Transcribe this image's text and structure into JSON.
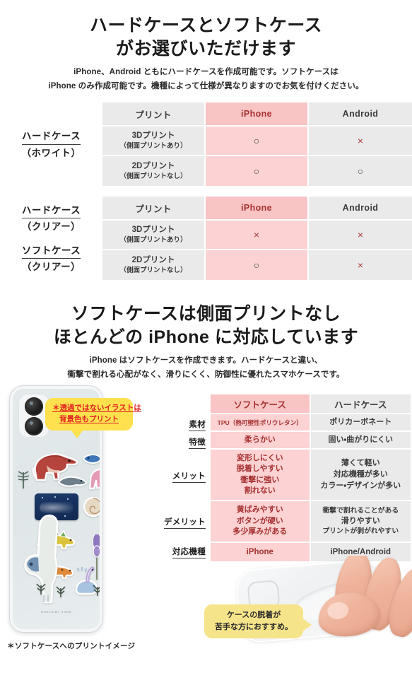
{
  "section1": {
    "heading_lines": [
      "ハードケースとソフトケース",
      "がお選びいただけます"
    ],
    "sub_lines": [
      "iPhone、Android ともにハードケースを作成可能です。ソフトケースは",
      "iPhone のみ作成可能です。機種によって仕様が異なりますのでお気を付けください。"
    ],
    "tables": [
      {
        "labels": [
          {
            "main": "ハードケース",
            "paren": "（ホワイト）"
          }
        ],
        "columns": [
          "プリント",
          "iPhone",
          "Android"
        ],
        "rows": [
          {
            "print_main": "3Dプリント",
            "print_sub": "（側面プリントあり）",
            "iphone": "○",
            "android": "×"
          },
          {
            "print_main": "2Dプリント",
            "print_sub": "（側面プリントなし）",
            "iphone": "○",
            "android": "○"
          }
        ]
      },
      {
        "labels": [
          {
            "main": "ハードケース",
            "paren": "（クリアー）"
          },
          {
            "main": "ソフトケース",
            "paren": "（クリアー）"
          }
        ],
        "columns": [
          "プリント",
          "iPhone",
          "Android"
        ],
        "rows": [
          {
            "print_main": "3Dプリント",
            "print_sub": "（側面プリントあり）",
            "iphone": "×",
            "android": "×"
          },
          {
            "print_main": "2Dプリント",
            "print_sub": "（側面プリントなし）",
            "iphone": "○",
            "android": "×"
          }
        ]
      }
    ]
  },
  "section2": {
    "heading_lines": [
      "ソフトケースは側面プリントなし",
      "ほとんどの iPhone に対応しています"
    ],
    "sub_lines": [
      "iPhone はソフトケースを作成できます。ハードケースと違い、",
      "衝撃で割れる心配がなく、滑りにくく、防御性に優れたスマホケースです。"
    ],
    "callout_top": {
      "lines": [
        "＊透過ではないイラストは",
        "背景色もプリント"
      ]
    },
    "callout_bottom": {
      "lines": [
        "ケースの脱着が",
        "苦手な方におすすめ。"
      ]
    },
    "phone_brand_text": "Chocolat iroha",
    "comparison": {
      "columns": [
        "ソフトケース",
        "ハードケース"
      ],
      "rows": [
        {
          "label": "素材",
          "soft": [
            "TPU（熱可塑性ポリウレタン）"
          ],
          "hard": [
            "ポリカーボネート"
          ],
          "soft_small": true
        },
        {
          "label": "特徴",
          "soft": [
            "柔らかい"
          ],
          "hard": [
            "固い・曲がりにくい"
          ]
        },
        {
          "label": "メリット",
          "soft": [
            "変形しにくい",
            "脱着しやすい",
            "衝撃に強い",
            "割れない"
          ],
          "hard": [
            "薄くて軽い",
            "対応機種が多い",
            "カラー・デザインが多い"
          ]
        },
        {
          "label": "デメリット",
          "soft": [
            "黄ばみやすい",
            "ボタンが硬い",
            "多少厚みがある"
          ],
          "hard": [
            "衝撃で割れることがある",
            "滑りやすい",
            "プリントが剥がれやすい"
          ]
        },
        {
          "label": "対応機種",
          "soft": [
            "iPhone"
          ],
          "hard": [
            "iPhone/Android"
          ],
          "devices": true
        }
      ]
    }
  },
  "footnote": "＊ソフトケースへのプリントイメージ",
  "colors": {
    "pink_header": "#f9c4c4",
    "pink_cell": "#fcd2d2",
    "gray_cell": "#eaeaea",
    "red_text": "#a63232",
    "callout_yellow": "#ffe14f",
    "callout_pale_yellow": "#f6e48a"
  }
}
